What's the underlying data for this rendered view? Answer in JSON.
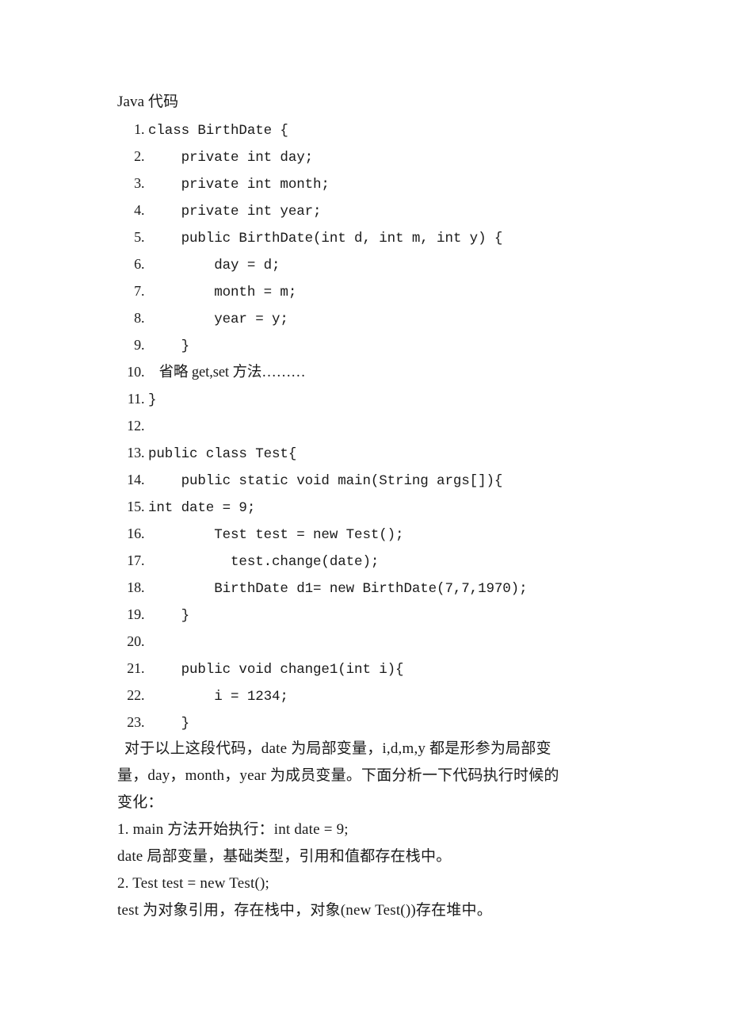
{
  "document": {
    "heading": "Java 代码",
    "code_listing": [
      {
        "number": "1",
        "indent": 0,
        "text": "class BirthDate {",
        "cjk": false
      },
      {
        "number": "2",
        "indent": 4,
        "text": "private int day;",
        "cjk": false
      },
      {
        "number": "3",
        "indent": 4,
        "text": "private int month;",
        "cjk": false
      },
      {
        "number": "4",
        "indent": 4,
        "text": "private int year;",
        "cjk": false
      },
      {
        "number": "5",
        "indent": 4,
        "text": "public BirthDate(int d, int m, int y) {",
        "cjk": false
      },
      {
        "number": "6",
        "indent": 8,
        "text": "day = d;",
        "cjk": false
      },
      {
        "number": "7",
        "indent": 8,
        "text": "month = m;",
        "cjk": false
      },
      {
        "number": "8",
        "indent": 8,
        "text": "year = y;",
        "cjk": false
      },
      {
        "number": "9",
        "indent": 4,
        "text": "}",
        "cjk": false
      },
      {
        "number": "10",
        "indent": 3,
        "text": "省略 get,set 方法………",
        "cjk": true
      },
      {
        "number": "11",
        "indent": 0,
        "text": "}",
        "cjk": false
      },
      {
        "number": "12",
        "indent": 0,
        "text": "",
        "cjk": false
      },
      {
        "number": "13",
        "indent": 0,
        "text": "public class Test{",
        "cjk": false
      },
      {
        "number": "14",
        "indent": 4,
        "text": "public static void main(String args[]){",
        "cjk": false
      },
      {
        "number": "15",
        "indent": 0,
        "text": "int date = 9;",
        "cjk": false
      },
      {
        "number": "16",
        "indent": 8,
        "text": "Test test = new Test();",
        "cjk": false
      },
      {
        "number": "17",
        "indent": 10,
        "text": "test.change(date);",
        "cjk": false
      },
      {
        "number": "18",
        "indent": 8,
        "text": "BirthDate d1= new BirthDate(7,7,1970);",
        "cjk": false
      },
      {
        "number": "19",
        "indent": 4,
        "text": "}",
        "cjk": false
      },
      {
        "number": "20",
        "indent": 0,
        "text": "",
        "cjk": false
      },
      {
        "number": "21",
        "indent": 4,
        "text": "public void change1(int i){",
        "cjk": false
      },
      {
        "number": "22",
        "indent": 8,
        "text": "i = 1234;",
        "cjk": false
      },
      {
        "number": "23",
        "indent": 4,
        "text": "}",
        "cjk": false
      }
    ],
    "explanation_paragraph": [
      "对于以上这段代码，date 为局部变量，i,d,m,y 都是形参为局部变",
      "量，day，month，year 为成员变量。下面分析一下代码执行时候的",
      "变化："
    ],
    "steps": [
      "1. main 方法开始执行：int date = 9;",
      "date 局部变量，基础类型，引用和值都存在栈中。",
      "2. Test test = new Test();",
      "test 为对象引用，存在栈中，对象(new Test())存在堆中。"
    ]
  }
}
